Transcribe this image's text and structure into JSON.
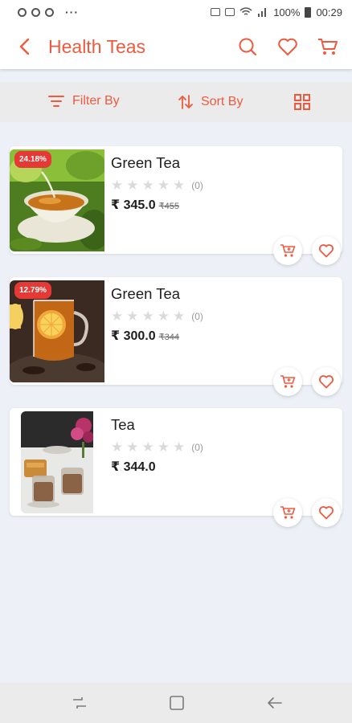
{
  "status_bar": {
    "icons_left": [
      "notification-icon",
      "notification-icon",
      "notification-icon"
    ],
    "more": "···",
    "battery_percent": "100%",
    "time": "00:29"
  },
  "header": {
    "title": "Health Teas",
    "back_icon": "chevron-left-icon",
    "actions": [
      "search-icon",
      "heart-icon",
      "cart-icon"
    ],
    "accent_color": "#ef5a3f"
  },
  "filter_bar": {
    "filter_label": "Filter By",
    "sort_label": "Sort By",
    "layout_icon": "grid-icon"
  },
  "products": [
    {
      "name": "Green Tea",
      "discount": "24.18%",
      "rating_count": "(0)",
      "stars": 0,
      "price": "₹ 345.0",
      "old_price": "₹455"
    },
    {
      "name": "Green Tea",
      "discount": "12.79%",
      "rating_count": "(0)",
      "stars": 0,
      "price": "₹ 300.0",
      "old_price": "₹344"
    },
    {
      "name": "Tea",
      "discount": "",
      "rating_count": "(0)",
      "stars": 0,
      "price": "₹ 344.0",
      "old_price": ""
    }
  ],
  "nav_bar": {
    "buttons": [
      "recents-icon",
      "home-icon",
      "back-icon"
    ]
  }
}
